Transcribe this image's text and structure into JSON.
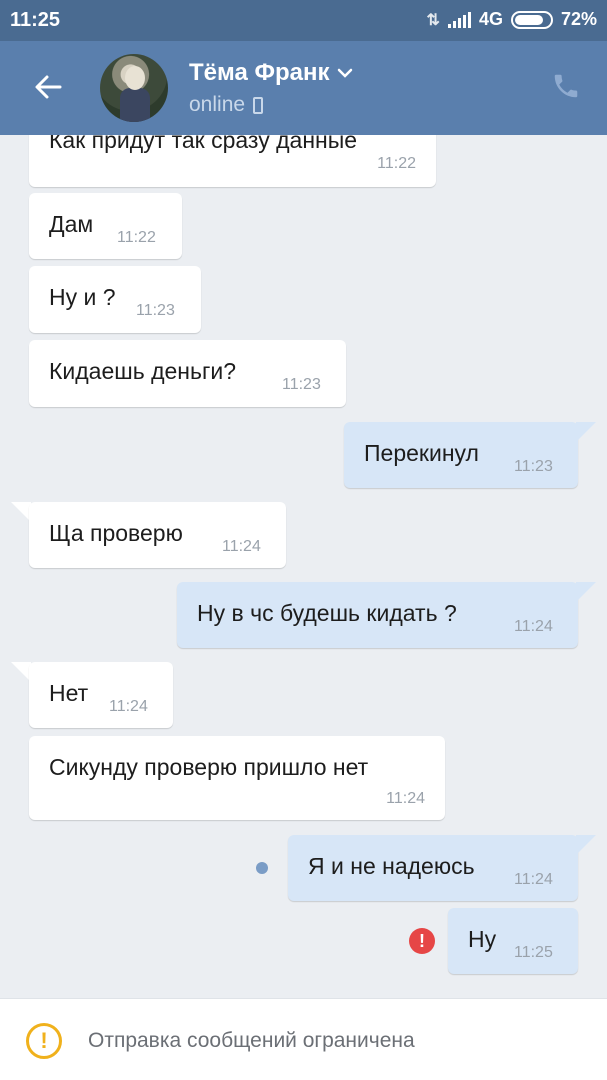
{
  "statusbar": {
    "time": "11:25",
    "network": "4G",
    "battery": "72%"
  },
  "header": {
    "name": "Тёма Франк",
    "status": "online",
    "icons": {
      "back": "back-arrow-icon",
      "dropdown": "chevron-down-icon",
      "device": "phone-device-icon",
      "call": "phone-call-icon"
    }
  },
  "messages": [
    {
      "text": "Как придут так сразу данные",
      "time": "11:22",
      "direction": "in"
    },
    {
      "text": "Дам",
      "time": "11:22",
      "direction": "in"
    },
    {
      "text": "Ну и ?",
      "time": "11:23",
      "direction": "in"
    },
    {
      "text": "Кидаешь деньги?",
      "time": "11:23",
      "direction": "in"
    },
    {
      "text": "Перекинул",
      "time": "11:23",
      "direction": "out"
    },
    {
      "text": "Ща проверю",
      "time": "11:24",
      "direction": "in"
    },
    {
      "text": "Ну в чс будешь кидать ?",
      "time": "11:24",
      "direction": "out"
    },
    {
      "text": "Нет",
      "time": "11:24",
      "direction": "in"
    },
    {
      "text": "Сикунду проверю пришло нет",
      "time": "11:24",
      "direction": "in"
    },
    {
      "text": "Я и не надеюсь",
      "time": "11:24",
      "direction": "out",
      "state": "unread"
    },
    {
      "text": "Ну",
      "time": "11:25",
      "direction": "out",
      "state": "error"
    }
  ],
  "bottom": {
    "notice": "Отправка сообщений ограничена",
    "icon": "warning-icon"
  },
  "colors": {
    "header": "#5a7fad",
    "statusbar": "#4a6b91",
    "background": "#ebeef2",
    "outgoing": "#d7e6f7",
    "incoming": "#ffffff",
    "error": "#e64646",
    "warning": "#f0b11c"
  }
}
